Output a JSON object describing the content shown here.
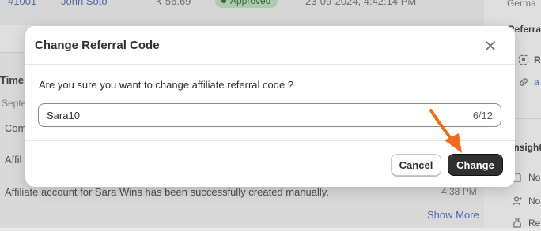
{
  "background": {
    "order_row": {
      "order_id": "#1001",
      "customer": "John Soto",
      "amount": "₹ 56.69",
      "status": "Approved",
      "date": "23-09-2024, 4:42:14 PM"
    },
    "timeline": {
      "title": "Timeline",
      "date": "September",
      "items": [
        "Com",
        "Affil",
        "Affiliate account for Sara Wins has been successfully created manually."
      ],
      "last_time": "4:38 PM",
      "show_more": "Show More"
    },
    "sidebar": {
      "country": "Germa",
      "referral_heading": "Referra",
      "referral_code_label": "R",
      "referral_link_label": "a",
      "insights_heading": "Insight",
      "insight_items": [
        "No",
        "No",
        "Re"
      ]
    }
  },
  "modal": {
    "title": "Change Referral Code",
    "question": "Are you sure you want to change affiliate referral code ?",
    "input_value": "Sara10",
    "char_count": "6/12",
    "cancel_label": "Cancel",
    "change_label": "Change"
  },
  "colors": {
    "primary_button": "#303030",
    "annotation_arrow": "#f26b1d",
    "status_badge": "#b8d7b9"
  },
  "icons": {
    "close": "close-icon",
    "annotation": "orange-arrow-icon"
  }
}
